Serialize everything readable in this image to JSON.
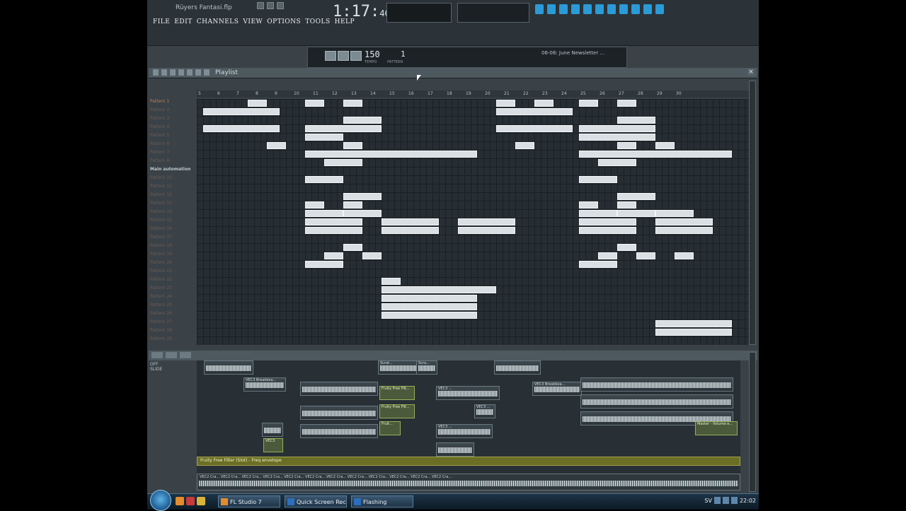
{
  "app": {
    "window_title": "Rüyers Fantasi.flp",
    "menu": [
      "FILE",
      "EDIT",
      "CHANNELS",
      "VIEW",
      "OPTIONS",
      "TOOLS",
      "HELP"
    ],
    "time_main": "1:17",
    "time_sub": "46",
    "tempo": "150",
    "tempo_label": "TEMPO",
    "pattern_number": "1",
    "pattern_label": "PATTERN",
    "hint_text": "06-08: June Newsletter ..."
  },
  "playlist": {
    "title": "Playlist",
    "ruler_marks": [
      "5",
      "6",
      "7",
      "8",
      "9",
      "10",
      "11",
      "12",
      "13",
      "14",
      "15",
      "16",
      "17",
      "18",
      "19",
      "20",
      "21",
      "22",
      "23",
      "24",
      "25",
      "26",
      "27",
      "28",
      "29",
      "30"
    ],
    "patterns": [
      "Pattern 1",
      "Pattern 2",
      "Pattern 3",
      "Pattern 4",
      "Pattern 5",
      "Pattern 6",
      "Pattern 7",
      "Pattern 8",
      "Main automation",
      "Pattern 10",
      "Pattern 11",
      "Pattern 12",
      "Pattern 13",
      "Pattern 14",
      "Pattern 15",
      "Pattern 16",
      "Pattern 17",
      "Pattern 18",
      "Pattern 19",
      "Pattern 20",
      "Pattern 21",
      "Pattern 22",
      "Pattern 23",
      "Pattern 24",
      "Pattern 25",
      "Pattern 26",
      "Pattern 27",
      "Pattern 28",
      "Pattern 29"
    ]
  },
  "lanes": {
    "left_labels": [
      "OFF",
      "SLIDE"
    ],
    "clip_labels": {
      "scrat1": "Scrat...",
      "scrat2": "Scra...",
      "vec3_breakbea1": "VEC3 Breakbea...",
      "vec3_breakbea2": "VEC3 Breakbea...",
      "fruity_free_filt": "Fruity Free Filt...",
      "fruity_free_filt2": "Fruity Free Filt...",
      "vec3_a": "VEC3 ...",
      "vec3_b": "VEC3 ...",
      "vec3_c": "VEC3 ...",
      "fruit_short": "Fruit...",
      "vec3_d": "VEC3",
      "master_volume": "Master - Volume e..."
    },
    "freq_envelope": "Fruity Free Filter (Slot) - Freq envelope",
    "bottom_clip": "VEC2 Cra... VEC2 Cra... VEC2 Cra... VEC2 Cra... VEC2 Cra... VEC2 Cra... VEC2 Cra... VEC2 Cra... VEC2 Cra... VEC2 Cra... VEC2 Cra... VEC2 Cra..."
  },
  "taskbar": {
    "tasks": [
      "FL Studio 7",
      "Quick Screen Recor...",
      "Flashing"
    ],
    "lang": "SV",
    "clock": "22:02"
  }
}
